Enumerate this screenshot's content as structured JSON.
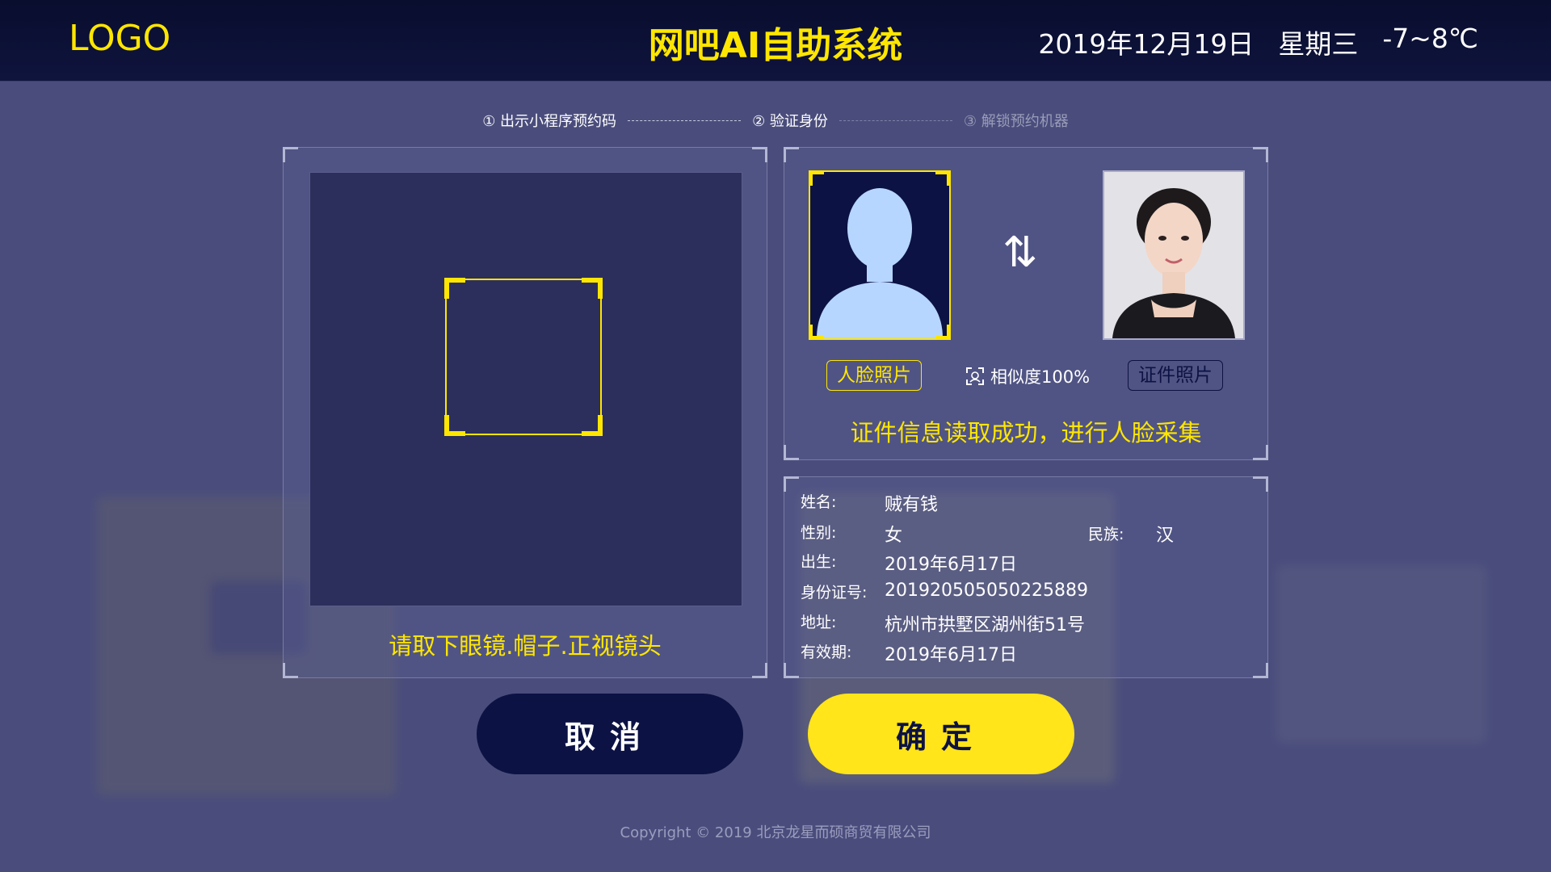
{
  "header": {
    "logo": "LOGO",
    "title": "网吧AI自助系统",
    "date": "2019年12月19日",
    "weekday": "星期三",
    "temperature": "-7~8℃"
  },
  "steps": [
    {
      "label": "① 出示小程序预约码",
      "state": "done"
    },
    {
      "label": "② 验证身份",
      "state": "active"
    },
    {
      "label": "③ 解锁预约机器",
      "state": "inactive"
    }
  ],
  "camera": {
    "tip": "请取下眼镜.帽子.正视镜头"
  },
  "compare": {
    "face_tag": "人脸照片",
    "id_tag": "证件照片",
    "similarity": "相似度100%",
    "status": "证件信息读取成功，进行人脸采集",
    "swap_icon": "swap-vertical-arrows"
  },
  "id_info": {
    "name_label": "姓名:",
    "name": "贼有钱",
    "gender_label": "性别:",
    "gender": "女",
    "ethnic_label": "民族:",
    "ethnic": "汉",
    "birth_label": "出生:",
    "birth": "2019年6月17日",
    "id_label": "身份证号:",
    "id_number": "201920505050225889",
    "address_label": "地址:",
    "address": "杭州市拱墅区湖州街51号",
    "valid_label": "有效期:",
    "valid": "2019年6月17日"
  },
  "buttons": {
    "cancel": "取消",
    "confirm": "确定"
  },
  "footer": {
    "copyright": "Copyright © 2019  北京龙星而硕商贸有限公司"
  },
  "colors": {
    "accent": "#ffe600",
    "navy": "#0c1244",
    "background": "#4a4d7c"
  }
}
